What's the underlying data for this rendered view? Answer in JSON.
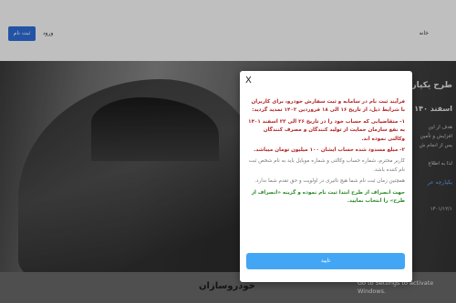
{
  "navbar": {
    "register_label": "ثبت نام",
    "login_label": "ورود",
    "home_label": "خانه"
  },
  "hero": {
    "title": "طرح یکپارچ",
    "subtitle": "اسفند ۱۴۰",
    "lines": [
      "هدف از این",
      "افزایش و تأمین",
      "پس از انجام ش",
      "لذا به اطلاع"
    ],
    "link": "یکپارچه عر",
    "date": "۱۴۰۱/۱۲/۱"
  },
  "lower": {
    "title": "خودروسازان"
  },
  "modal": {
    "close_label": "X",
    "para1": "فرآیند ثبت نام در سامانه و ثبت سفارش خودرو، برای کاربران با شرایط ذیل، از تاریخ ۱۶ الی ۱۸ فروردین ۱۴۰۲ تمدید گردید:",
    "para2": "۱- متقاضیانی که حساب خود را در تاریخ ۲۶ الی ۲۳ اسفند ۱۴۰۱ به نفع سازمان حمایت از تولید کنندگان و مصرف کنندگان وکالتی نموده اند.",
    "para3": "۲- مبلغ مسدود شده حساب ایشان ۱۰۰ میلیون تومان میباشد.",
    "para4": "کاربر محترم، شماره حساب وکالتی و شماره موبایل باید به نام شخص ثبت نام کننده باشد.",
    "para5": "همچنین زمان ثبت نام شما هیچ تاثیری در اولویت و حق تقدم شما ندارد.",
    "para6": "جهت انصراف از طرح ابتدا ثبت نام نموده و گزینه «انصراف از طرح» را انتخاب نمایید.",
    "confirm_label": "تایید"
  },
  "watermark": {
    "line1": "Activate Windows",
    "line2": "Go to Settings to activate Windows."
  },
  "colors": {
    "primary_button": "#2f6fdc",
    "confirm_button": "#43a6f5",
    "red_text": "#b32525",
    "green_text": "#2d8a2d"
  }
}
